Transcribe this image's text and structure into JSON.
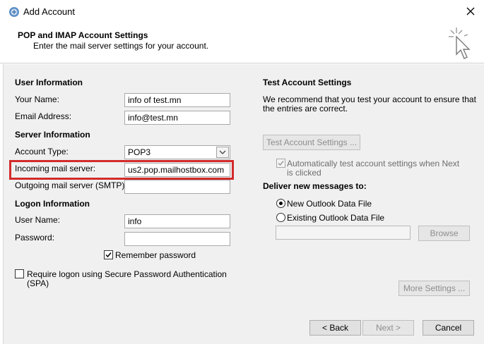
{
  "window": {
    "title": "Add Account",
    "colors": {
      "highlight": "#d22b2b",
      "panel": "#f0f0f0"
    }
  },
  "header": {
    "title": "POP and IMAP Account Settings",
    "subtitle": "Enter the mail server settings for your account."
  },
  "user_info": {
    "heading": "User Information",
    "name_label": "Your Name:",
    "name_value": "info of test.mn",
    "email_label": "Email Address:",
    "email_value": "info@test.mn"
  },
  "server_info": {
    "heading": "Server Information",
    "account_type_label": "Account Type:",
    "account_type_value": "POP3",
    "incoming_label": "Incoming mail server:",
    "incoming_value": "us2.pop.mailhostbox.com",
    "outgoing_label": "Outgoing mail server (SMTP):",
    "outgoing_value": ""
  },
  "logon_info": {
    "heading": "Logon Information",
    "user_label": "User Name:",
    "user_value": "info",
    "password_label": "Password:",
    "password_value": "",
    "remember_label": "Remember password",
    "remember_checked": true,
    "spa_label_line1": "Require logon using Secure Password Authentication",
    "spa_label_line2": "(SPA)",
    "spa_checked": false
  },
  "test_settings": {
    "heading": "Test Account Settings",
    "desc_line1": "We recommend that you test your account to ensure that",
    "desc_line2": "the entries are correct.",
    "test_button": "Test Account Settings ...",
    "auto_test_line1": "Automatically test account settings when Next",
    "auto_test_line2": "is clicked",
    "auto_test_checked": true
  },
  "deliver": {
    "heading": "Deliver new messages to:",
    "option_new": "New Outlook Data File",
    "option_existing": "Existing Outlook Data File",
    "selected": "new",
    "browse_button": "Browse"
  },
  "buttons": {
    "more_settings": "More Settings ...",
    "back": "< Back",
    "next": "Next >",
    "cancel": "Cancel"
  }
}
